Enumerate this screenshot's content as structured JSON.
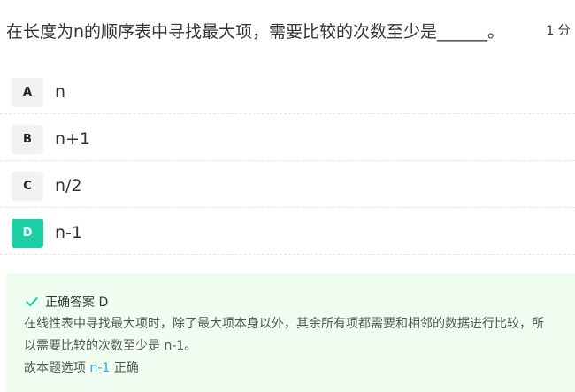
{
  "question": {
    "text": "在长度为n的顺序表中寻找最大项，需要比较的次数至少是______。",
    "score": "1 分"
  },
  "options": [
    {
      "letter": "A",
      "text": "n"
    },
    {
      "letter": "B",
      "text": "n+1"
    },
    {
      "letter": "C",
      "text": "n/2"
    },
    {
      "letter": "D",
      "text": "n-1"
    }
  ],
  "answer": {
    "title": "正确答案 D",
    "explanation": "在线性表中寻找最大项时，除了最大项本身以外，其余所有项都需要和相邻的数据进行比较，所以需要比较的次数至少是 n-1。",
    "conclusion_prefix": "故本题选项 ",
    "conclusion_option": "n-1",
    "conclusion_suffix": " 正确"
  },
  "colors": {
    "correct_accent": "#1fcfa6",
    "answer_bg": "#effdf0",
    "highlight": "#25aee0"
  },
  "icons": {
    "answer_icon": "check-icon"
  }
}
